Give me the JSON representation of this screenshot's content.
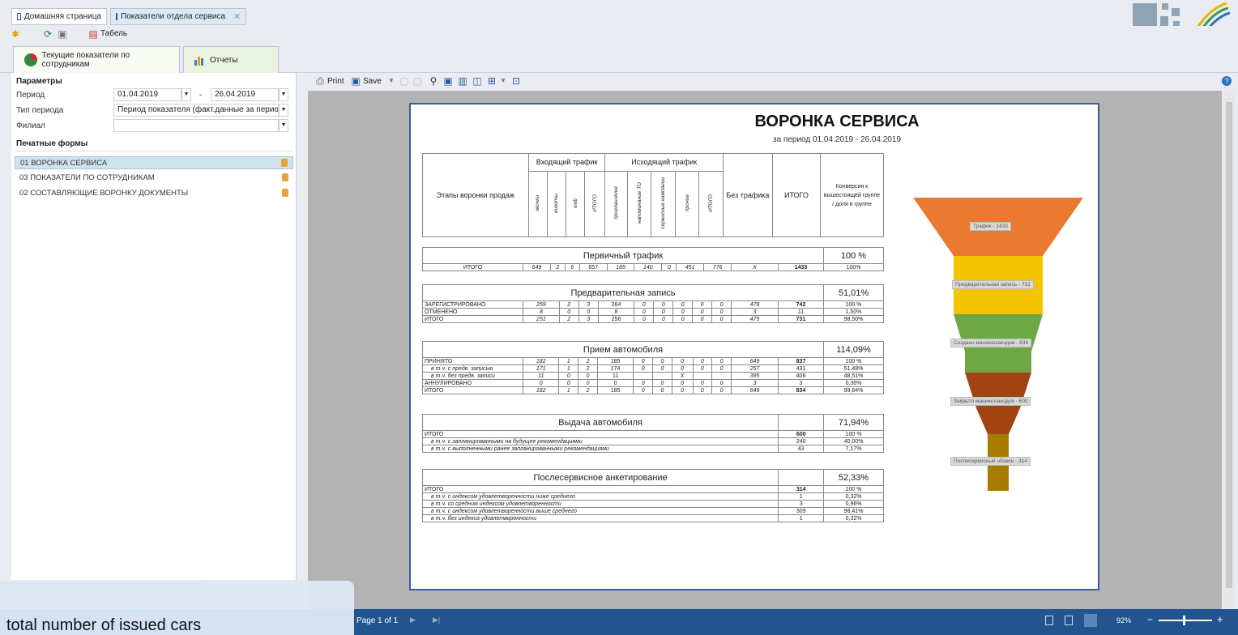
{
  "tabs": [
    {
      "label": "Домашняя страница"
    },
    {
      "label": "Показатели отдела сервиса"
    }
  ],
  "toolbar": {
    "tabel_label": "Табель"
  },
  "main_tabs": [
    {
      "label": "Текущие показатели по сотрудникам"
    },
    {
      "label": "Отчеты"
    }
  ],
  "params": {
    "header": "Параметры",
    "period_label": "Период",
    "period_from": "01.04.2019",
    "period_sep": "-",
    "period_to": "26.04.2019",
    "period_type_label": "Тип периода",
    "period_type_value": "Период показателя (факт.данные за период)",
    "branch_label": "Филиал",
    "branch_value": ""
  },
  "print_forms": {
    "header": "Печатные формы",
    "items": [
      {
        "label": "01 ВОРОНКА СЕРВИСА"
      },
      {
        "label": "03 ПОКАЗАТЕЛИ ПО СОТРУДНИКАМ"
      },
      {
        "label": "02 СОСТАВЛЯЮЩИЕ ВОРОНКУ ДОКУМЕНТЫ"
      }
    ]
  },
  "report_toolbar": {
    "print_label": "Print",
    "save_label": "Save"
  },
  "report": {
    "title": "ВОРОНКА СЕРВИСА",
    "subtitle": "за период 01.04.2019 - 26.04.2019",
    "header": {
      "stages": "Этапы воронки продаж",
      "incoming": "Входящий трафик",
      "outgoing": "Исходящий трафик",
      "in_cols": [
        "звонки",
        "визиты",
        "web",
        "ИТОГО"
      ],
      "out_cols": [
        "приглашение",
        "напоминание ТО",
        "сервисные кампании",
        "прочие",
        "ИТОГО"
      ],
      "no_traffic": "Без трафика",
      "total": "ИТОГО",
      "conversion": "Конверсия к вышестоящей группе / доля в группе"
    },
    "sections": [
      {
        "title": "Первичный трафик",
        "pct": "100 %",
        "rows": [
          {
            "label": "ИТОГО",
            "center": true,
            "cells": [
              "649",
              "2",
              "6",
              "657",
              "185",
              "140",
              "0",
              "451",
              "776",
              "X",
              "1433",
              "100%"
            ]
          }
        ]
      },
      {
        "title": "Предварительная запись",
        "pct": "51,01%",
        "rows": [
          {
            "label": "ЗАРЕГИСТРИРОВАНО",
            "cells": [
              "259",
              "2",
              "3",
              "264",
              "0",
              "0",
              "0",
              "0",
              "0",
              "478",
              "742",
              "100 %"
            ]
          },
          {
            "label": "ОТМЕНЕНО",
            "cells": [
              "8",
              "0",
              "0",
              "8",
              "0",
              "0",
              "0",
              "0",
              "0",
              "3",
              "11",
              "1,50%"
            ]
          },
          {
            "label": "ИТОГО",
            "cells": [
              "251",
              "2",
              "3",
              "256",
              "0",
              "0",
              "0",
              "0",
              "0",
              "475",
              "731",
              "98,50%"
            ]
          }
        ]
      },
      {
        "title": "Прием автомобиля",
        "pct": "114,09%",
        "rows": [
          {
            "label": "ПРИНЯТО",
            "cells": [
              "182",
              "1",
              "2",
              "185",
              "0",
              "0",
              "0",
              "0",
              "0",
              "649",
              "837",
              "100 %"
            ]
          },
          {
            "label": "в т.ч. с предв. записью",
            "sub": true,
            "cells": [
              "171",
              "1",
              "2",
              "174",
              "0",
              "0",
              "0",
              "0",
              "0",
              "257",
              "431",
              "51,49%"
            ]
          },
          {
            "label": "в т.ч. без предв. записи",
            "sub": true,
            "cells": [
              "11",
              "0",
              "0",
              "11",
              "",
              "",
              "X",
              "",
              "",
              "395",
              "406",
              "48,51%"
            ]
          },
          {
            "label": "АННУЛИРОВАНО",
            "cells": [
              "0",
              "0",
              "0",
              "0",
              "0",
              "0",
              "0",
              "0",
              "0",
              "3",
              "3",
              "0,36%"
            ]
          },
          {
            "label": "ИТОГО",
            "cells": [
              "182",
              "1",
              "2",
              "185",
              "0",
              "0",
              "0",
              "0",
              "0",
              "649",
              "834",
              "99,64%"
            ]
          }
        ]
      },
      {
        "title": "Выдача автомобиля",
        "pct": "71,94%",
        "rows": [
          {
            "label": "ИТОГО",
            "value": "600",
            "share": "100 %"
          },
          {
            "label": "в т.ч. с запланированными на будущее рекомендациями",
            "sub": true,
            "value": "240",
            "share": "40,00%"
          },
          {
            "label": "в т.ч. с выполненными ранее запланированными рекомендациями",
            "sub": true,
            "value": "43",
            "share": "7,17%"
          }
        ]
      },
      {
        "title": "Послесервисное анкетирование",
        "pct": "52,33%",
        "rows": [
          {
            "label": "ИТОГО",
            "value": "314",
            "share": "100 %"
          },
          {
            "label": "в т.ч. с индексом удовлетворенности ниже среднего",
            "sub": true,
            "value": "1",
            "share": "0,32%"
          },
          {
            "label": "в т.ч. со средним индексом удовлетворенности",
            "sub": true,
            "value": "3",
            "share": "0,96%"
          },
          {
            "label": "в т.ч. с индексом удовлетворенности выше среднего",
            "sub": true,
            "value": "309",
            "share": "98,41%"
          },
          {
            "label": "в т.ч. без индекса удовлетворенности",
            "sub": true,
            "value": "1",
            "share": "0,32%"
          }
        ]
      }
    ],
    "funnel": [
      {
        "label": "Трафик - 1433",
        "color": "#e97a2f"
      },
      {
        "label": "Предварительная запись - 731",
        "color": "#f5c400"
      },
      {
        "label": "Создано машинозаездов - 834",
        "color": "#6ea845"
      },
      {
        "label": "Закрыто машинозаездов - 600",
        "color": "#a24412"
      },
      {
        "label": "Послесервисный обзвон - 314",
        "color": "#a57c00"
      }
    ]
  },
  "status": {
    "page": "Page 1 of 1",
    "zoom": "92%"
  },
  "caption": "total number of issued cars"
}
